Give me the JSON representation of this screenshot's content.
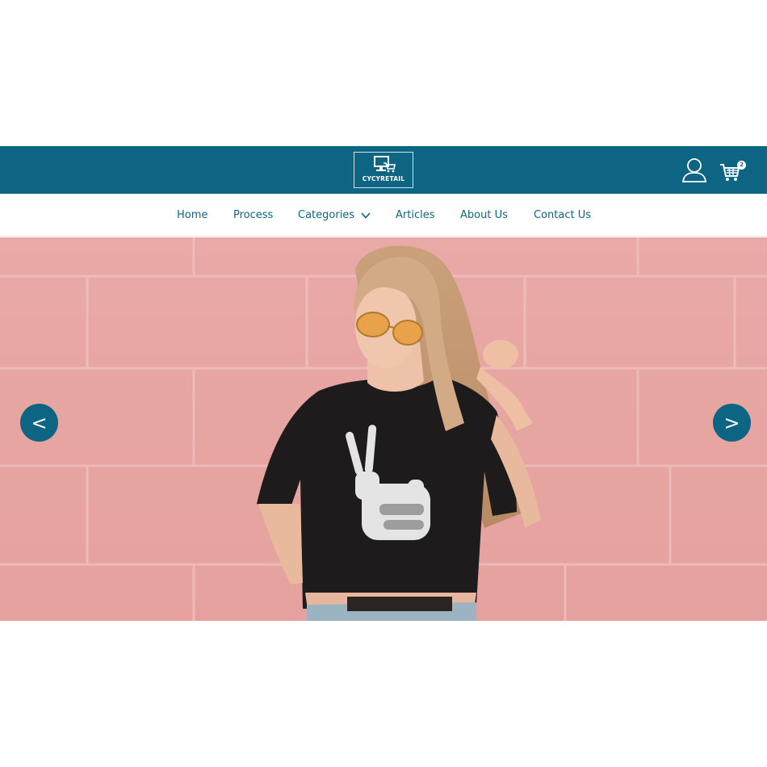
{
  "brand": {
    "logo_text": "CYCYRETAIL",
    "header_color": "#0e6583"
  },
  "header": {
    "user_icon": "user-icon",
    "cart_icon": "cart-icon",
    "cart_count": "2"
  },
  "nav": {
    "items": [
      {
        "label": "Home"
      },
      {
        "label": "Process"
      },
      {
        "label": "Categories"
      },
      {
        "label": "Articles"
      },
      {
        "label": "About Us"
      },
      {
        "label": "Contact Us"
      }
    ],
    "dropdown_icon": "chevron-down-icon"
  },
  "carousel": {
    "prev_label": "<",
    "next_label": ">",
    "slide_image": "woman-peace-sign-tshirt-photo"
  }
}
